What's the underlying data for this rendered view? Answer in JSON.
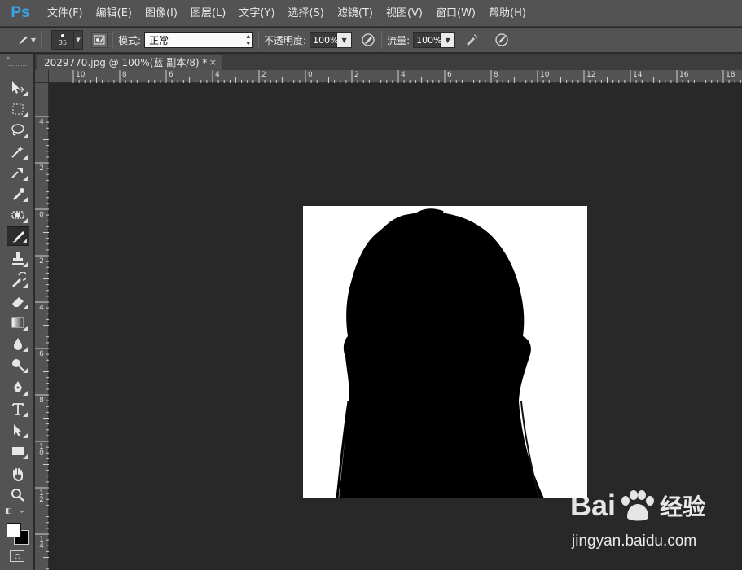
{
  "app": {
    "logo": "Ps"
  },
  "menu": [
    "文件(F)",
    "编辑(E)",
    "图像(I)",
    "图层(L)",
    "文字(Y)",
    "选择(S)",
    "滤镜(T)",
    "视图(V)",
    "窗口(W)",
    "帮助(H)"
  ],
  "options": {
    "brush_size": "35",
    "mode_label": "模式:",
    "mode_value": "正常",
    "opacity_label": "不透明度:",
    "opacity_value": "100%",
    "flow_label": "流量:",
    "flow_value": "100%"
  },
  "document": {
    "tab_title": "2029770.jpg @ 100%(蓝 副本/8) *",
    "close": "×"
  },
  "ruler": {
    "top_labels": [
      "10",
      "8",
      "6",
      "4",
      "2",
      "0",
      "2",
      "4",
      "6",
      "8",
      "10",
      "12",
      "14",
      "16",
      "18"
    ],
    "left_labels": [
      "4",
      "2",
      "0",
      "2",
      "4",
      "6",
      "8",
      "10",
      "12",
      "14"
    ]
  },
  "colors": {
    "foreground": "#ffffff",
    "background": "#000000",
    "ui_panel": "#535353",
    "workspace": "#282828",
    "ps_blue": "#3aa4e8"
  },
  "watermark": {
    "brand_left": "Bai",
    "brand_right": "经验",
    "url": "jingyan.baidu.com"
  }
}
